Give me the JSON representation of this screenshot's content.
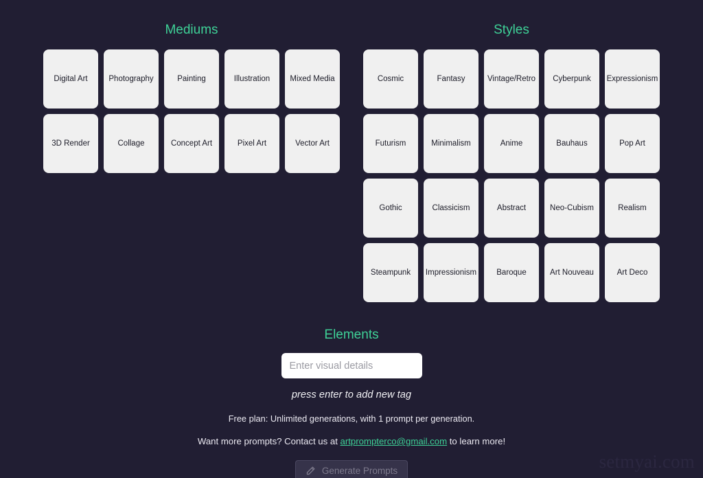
{
  "background_color": "#211e33",
  "accent_color": "#3ed197",
  "tile_color": "#f0f0f0",
  "mediums": {
    "title": "Mediums",
    "tiles": [
      "Digital Art",
      "Photography",
      "Painting",
      "Illustration",
      "Mixed Media",
      "3D Render",
      "Collage",
      "Concept Art",
      "Pixel Art",
      "Vector Art"
    ]
  },
  "styles": {
    "title": "Styles",
    "tiles": [
      "Cosmic",
      "Fantasy",
      "Vintage/Retro",
      "Cyberpunk",
      "Expressionism",
      "Futurism",
      "Minimalism",
      "Anime",
      "Bauhaus",
      "Pop Art",
      "Gothic",
      "Classicism",
      "Abstract",
      "Neo-Cubism",
      "Realism",
      "Steampunk",
      "Impressionism",
      "Baroque",
      "Art Nouveau",
      "Art Deco"
    ]
  },
  "elements": {
    "title": "Elements",
    "input_placeholder": "Enter visual details",
    "input_value": "",
    "hint": "press enter to add new tag"
  },
  "footer": {
    "plan_note": "Free plan: Unlimited generations, with 1 prompt per generation.",
    "contact_prefix": "Want more prompts? Contact us at ",
    "contact_email": "artprompterco@gmail.com",
    "contact_suffix": " to learn more!",
    "generate_label": "Generate Prompts",
    "generate_icon": "pencil-icon",
    "watermark": "setmyai.com"
  }
}
